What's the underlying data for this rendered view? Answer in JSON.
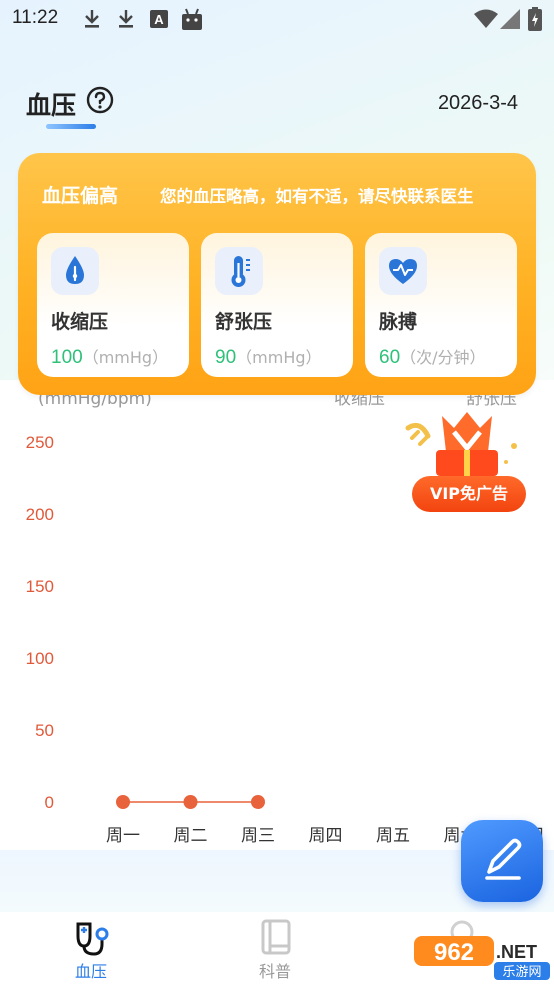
{
  "status_bar": {
    "time": "11:22",
    "left_icons": [
      "download-icon",
      "download-icon",
      "font-a-icon",
      "android-icon"
    ],
    "right_icons": [
      "wifi-icon",
      "signal-icon",
      "battery-charging-icon"
    ]
  },
  "header": {
    "title": "血压",
    "help_icon": "question-circle-icon",
    "date": "2026-3-4"
  },
  "alert": {
    "title": "血压偏高",
    "message": "您的血压略高，如有不适，请尽快联系医生",
    "metrics": [
      {
        "label": "收缩压",
        "value": "100",
        "unit": "（mmHg）",
        "icon": "drop-icon"
      },
      {
        "label": "舒张压",
        "value": "90",
        "unit": "（mmHg）",
        "icon": "thermometer-icon"
      },
      {
        "label": "脉搏",
        "value": "60",
        "unit": "（次/分钟）",
        "icon": "heart-pulse-icon"
      }
    ]
  },
  "vip": {
    "label": "VIP免广告"
  },
  "chart_data": {
    "type": "line",
    "ylabel": "(mmHg/bpm)",
    "legend": [
      "收缩压",
      "舒张压"
    ],
    "categories": [
      "周一",
      "周二",
      "周三",
      "周四",
      "周五",
      "周六",
      "周日"
    ],
    "y_ticks": [
      0,
      50,
      100,
      150,
      200,
      250
    ],
    "ylim": [
      0,
      250
    ],
    "series": [
      {
        "name": "收缩压",
        "values": [
          0,
          0,
          0
        ],
        "color": "#e8623c"
      }
    ],
    "grid": false
  },
  "tabbar": {
    "items": [
      {
        "label": "血压",
        "icon": "stethoscope-icon",
        "active": true
      },
      {
        "label": "科普",
        "icon": "book-icon",
        "active": false
      },
      {
        "label": "",
        "icon": "profile-icon",
        "active": false
      }
    ]
  },
  "watermark": {
    "text": "962.NET",
    "sub": "乐游网"
  },
  "colors": {
    "accent": "#2c7ee8",
    "alert_orange": "#ffb326",
    "value_green": "#2fc07a",
    "axis_red": "#e05a3a",
    "vip_red": "#f2440f"
  }
}
